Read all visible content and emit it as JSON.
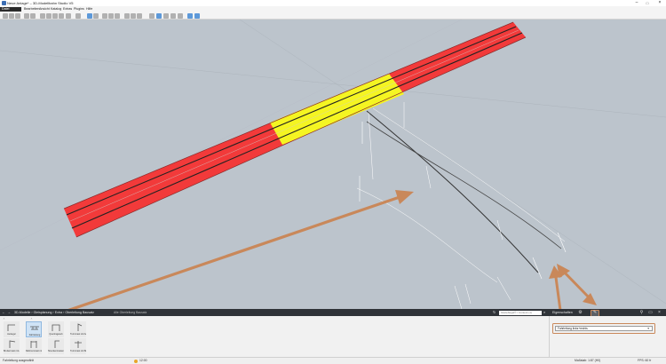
{
  "window": {
    "title": "Neue Anlage* – 3D-Modellbahn Studio V5"
  },
  "menu": {
    "file_label": "Datei",
    "items": [
      "Bearbeiten",
      "Ansicht",
      "Katalog",
      "Extras",
      "Plugins",
      "Hilfe"
    ]
  },
  "bottom": {
    "breadcrumb": "3D-Modelle  ›  Gleisplanung  ›  Extra  ›  Oberleitung Bausatz",
    "breadcrumb_tail": "Alle Oberleitung Bausatz",
    "search_placeholder": "Gleitebügel® / Content (1)"
  },
  "catalog": {
    "items": [
      {
        "label": "Ausleger",
        "selected": false
      },
      {
        "label": "Fahrleitung",
        "selected": true
      },
      {
        "label": "Quertragwerk",
        "selected": false
      },
      {
        "label": "Turmmast mit Au...",
        "selected": false
      },
      {
        "label": "Bruttermast mit Au...",
        "selected": false
      },
      {
        "label": "Rahmenmast mit Tr...",
        "selected": false
      },
      {
        "label": "Streckenmasten",
        "selected": false
      },
      {
        "label": "Turmmast mit Ba...",
        "selected": false
      }
    ]
  },
  "properties": {
    "title": "Eigenschaften",
    "dropdown_value": "Fahrleitung links+rechts",
    "icons": [
      "settings-icon",
      "catenary-tool-icon",
      "pin-icon",
      "window-icon",
      "close-icon"
    ]
  },
  "statusbar": {
    "left_text": "Fahrleitung ausgewählt",
    "zoom": "12:00",
    "scale": "Maßstab: 1:87 (H0)",
    "fps": "FPS: 60 fr"
  },
  "colors": {
    "track_red": "#f23a3a",
    "track_yellow": "#f5f522",
    "viewport_bg": "#bcc4cc",
    "annotation_orange": "#c9885a"
  }
}
